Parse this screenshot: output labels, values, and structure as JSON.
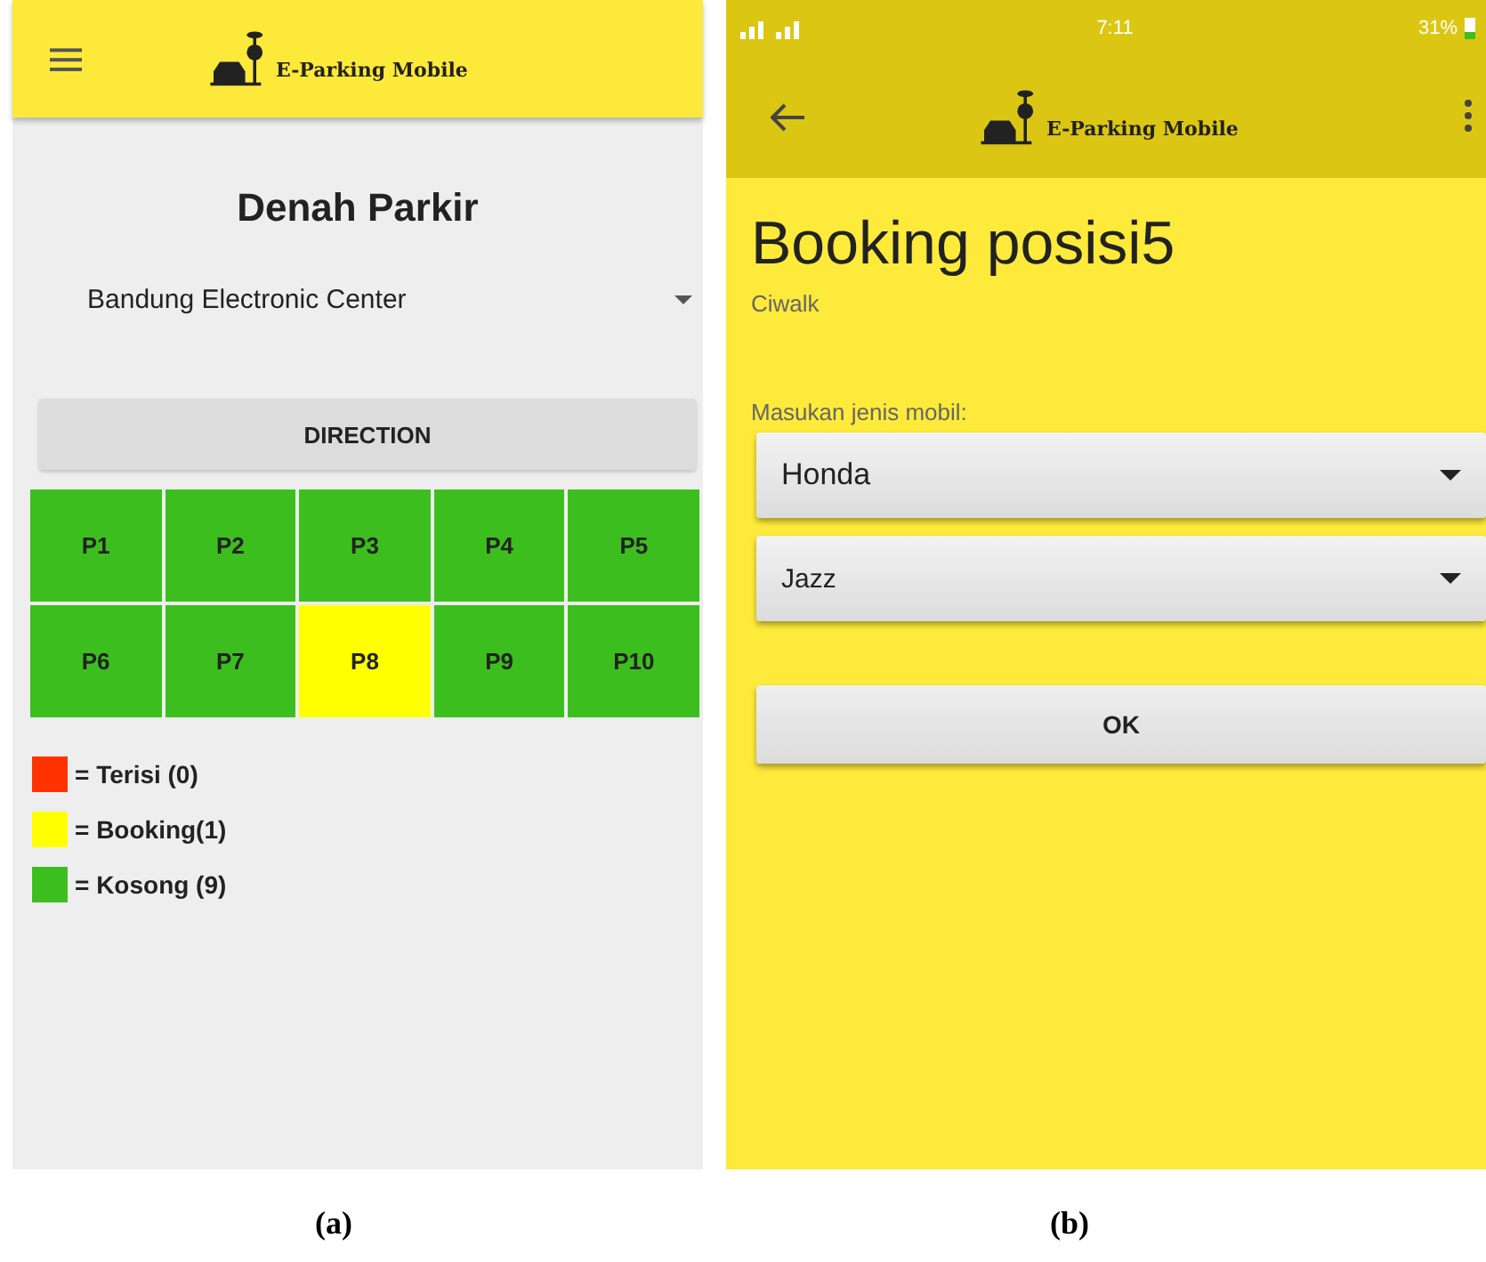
{
  "screen_a": {
    "app_title": "E-Parking Mobile",
    "title": "Denah Parkir",
    "location": "Bandung Electronic Center",
    "direction_button": "DIRECTION",
    "slots": [
      {
        "label": "P1",
        "color": "#3cbf1e"
      },
      {
        "label": "P2",
        "color": "#3cbf1e"
      },
      {
        "label": "P3",
        "color": "#3cbf1e"
      },
      {
        "label": "P4",
        "color": "#3cbf1e"
      },
      {
        "label": "P5",
        "color": "#3cbf1e"
      },
      {
        "label": "P6",
        "color": "#3cbf1e"
      },
      {
        "label": "P7",
        "color": "#3cbf1e"
      },
      {
        "label": "P8",
        "color": "#ffff00"
      },
      {
        "label": "P9",
        "color": "#3cbf1e"
      },
      {
        "label": "P10",
        "color": "#3cbf1e"
      }
    ],
    "legend": [
      {
        "label": "= Terisi (0)",
        "color": "#ff3300"
      },
      {
        "label": "= Booking(1)",
        "color": "#ffff00"
      },
      {
        "label": "= Kosong (9)",
        "color": "#3cbf1e"
      }
    ]
  },
  "screen_b": {
    "status_bar": {
      "time": "7:11",
      "battery": "31%"
    },
    "app_title": "E-Parking Mobile",
    "title": "Booking posisi5",
    "subtitle": "Ciwalk",
    "field_label": "Masukan jenis mobil:",
    "dropdowns": [
      "Honda",
      "Jazz"
    ],
    "ok_button": "OK"
  },
  "captions": [
    "(a)",
    "(b)"
  ]
}
